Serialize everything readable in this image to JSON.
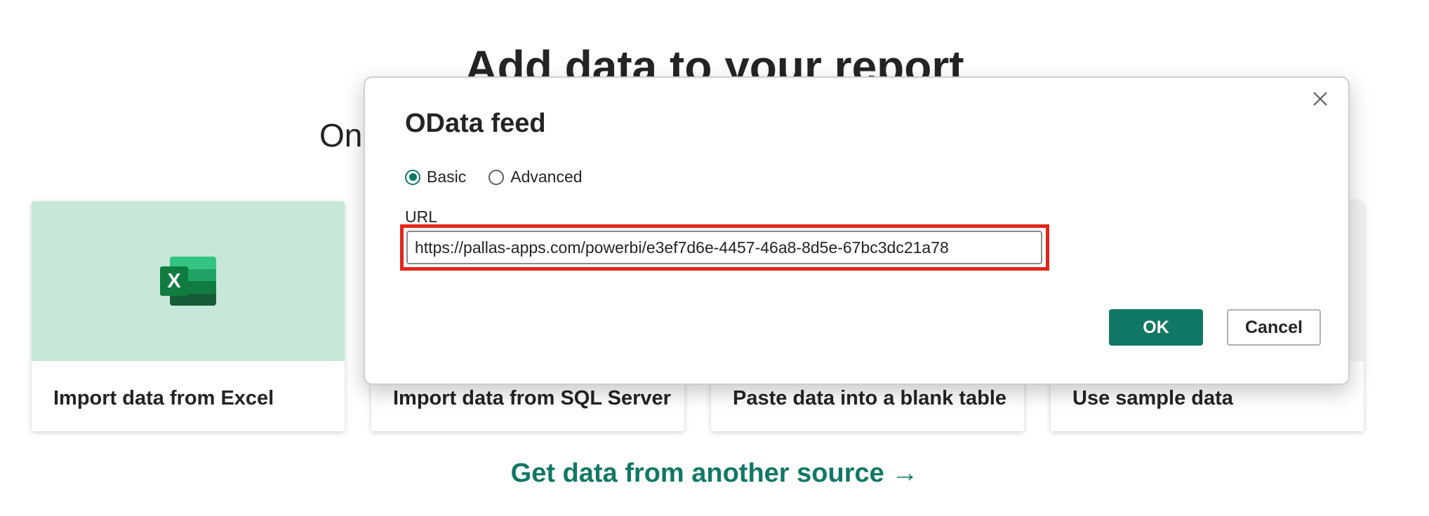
{
  "page": {
    "title": "Add data to your report",
    "subtitle_visible_fragment": "On",
    "cards": [
      {
        "label": "Import data from Excel",
        "icon": "excel-icon"
      },
      {
        "label": "Import data from SQL Server"
      },
      {
        "label": "Paste data into a blank table"
      },
      {
        "label": "Use sample data"
      }
    ],
    "get_data_link": "Get data from another source →"
  },
  "dialog": {
    "title": "OData feed",
    "close_icon": "close-icon",
    "radio_options": [
      {
        "label": "Basic",
        "checked": true
      },
      {
        "label": "Advanced",
        "checked": false
      }
    ],
    "url_label": "URL",
    "url_value": "https://pallas-apps.com/powerbi/e3ef7d6e-4457-46a8-8d5e-67bc3dc21a78",
    "ok_label": "OK",
    "cancel_label": "Cancel"
  },
  "colors": {
    "accent": "#117865",
    "highlight_border": "#e3261a",
    "excel_card_bg": "#c7e8d8",
    "excel_green": "#107c41"
  }
}
